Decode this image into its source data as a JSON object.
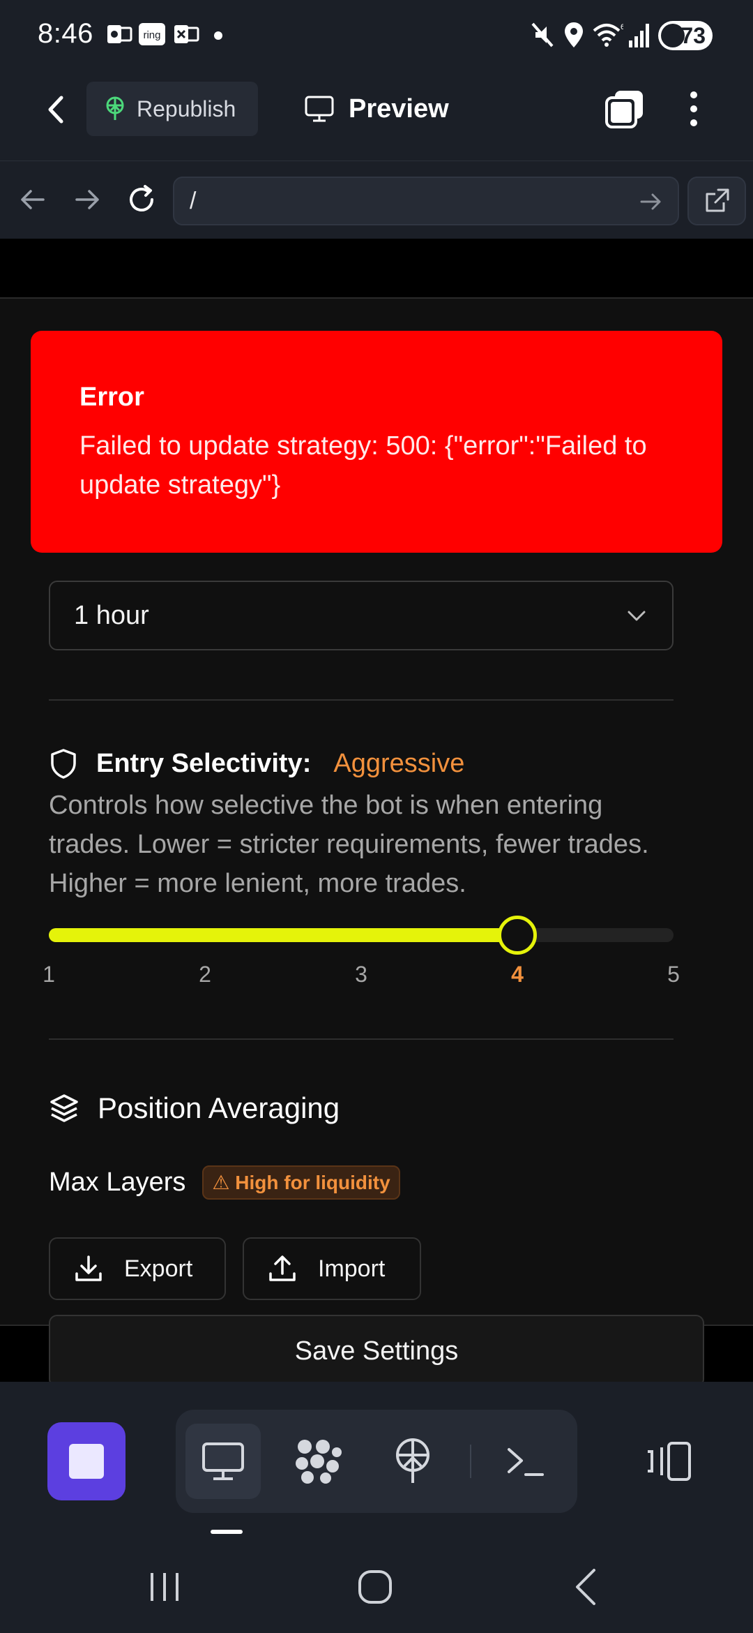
{
  "status_bar": {
    "time": "8:46",
    "battery": "73",
    "notification_icons": [
      "outlook-icon",
      "ring-icon",
      "teams-icon",
      "dot-icon"
    ],
    "system_icons": [
      "mute-icon",
      "location-icon",
      "wifi-icon",
      "signal-icon",
      "battery-icon"
    ]
  },
  "app_bar": {
    "republish_label": "Republish",
    "preview_label": "Preview"
  },
  "url_bar": {
    "value": "/"
  },
  "error": {
    "title": "Error",
    "message": "Failed to update strategy: 500: {\"error\":\"Failed to update strategy\"}"
  },
  "timeframe_select": {
    "value": "1 hour"
  },
  "entry_selectivity": {
    "label": "Entry Selectivity:",
    "value_label": "Aggressive",
    "description": "Controls how selective the bot is when entering trades. Lower = stricter requirements, fewer trades. Higher = more lenient, more trades.",
    "min": 1,
    "max": 5,
    "value": 4,
    "ticks": [
      "1",
      "2",
      "3",
      "4",
      "5"
    ]
  },
  "position_averaging": {
    "title": "Position Averaging",
    "max_layers_label": "Max Layers",
    "warning_badge": "⚠ High for liquidity"
  },
  "actions": {
    "export_label": "Export",
    "import_label": "Import",
    "save_label": "Save Settings"
  },
  "colors": {
    "error_bg": "#ff0000",
    "accent_orange": "#f2913d",
    "slider_yellow": "#e5f30a",
    "stop_button": "#5c3fe0"
  }
}
